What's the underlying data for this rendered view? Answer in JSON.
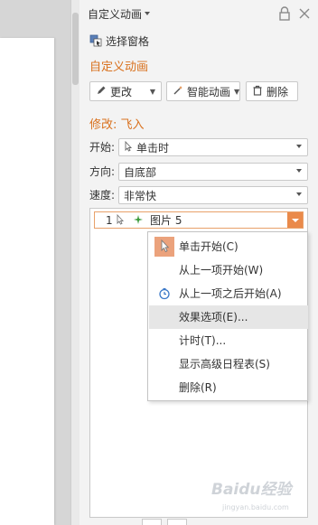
{
  "panel": {
    "title": "自定义动画",
    "selection_pane": "选择窗格",
    "section_title": "自定义动画",
    "change_button": "更改",
    "smart_animation_button": "智能动画",
    "delete_button": "删除",
    "modify_title": "修改: 飞入",
    "start_label": "开始:",
    "start_value": "单击时",
    "direction_label": "方向:",
    "direction_value": "自底部",
    "speed_label": "速度:",
    "speed_value": "非常快"
  },
  "list": {
    "item_number": "1",
    "item_name": "图片 5"
  },
  "menu": {
    "items": [
      "单击开始(C)",
      "从上一项开始(W)",
      "从上一项之后开始(A)",
      "效果选项(E)...",
      "计时(T)...",
      "显示高级日程表(S)",
      "删除(R)"
    ]
  },
  "colors": {
    "accent_orange": "#d9711e",
    "highlight": "#e6e6e6"
  },
  "watermark": {
    "text": "Baidu经验",
    "subtext": "jingyan.baidu.com"
  }
}
